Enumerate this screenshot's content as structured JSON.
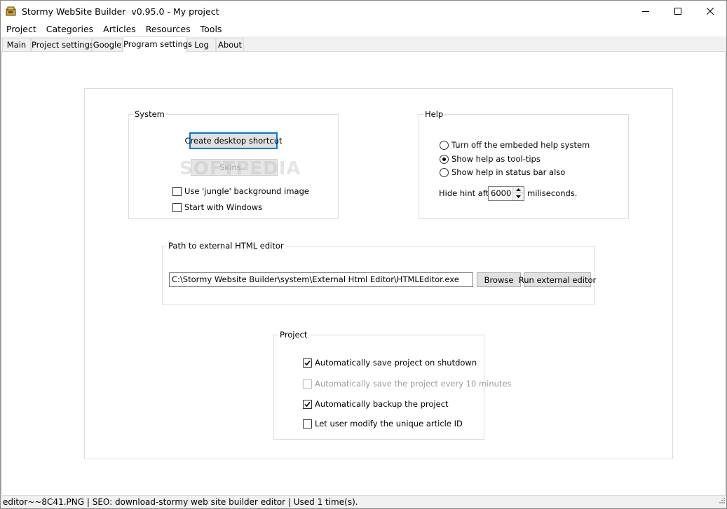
{
  "window": {
    "title": "Stormy WebSite Builder  v0.95.0 - My project"
  },
  "menu": [
    "Project",
    "Categories",
    "Articles",
    "Resources",
    "Tools"
  ],
  "tabs": [
    "Main",
    "Project settings",
    "Google",
    "Program settings",
    "Log",
    "About"
  ],
  "active_tab": "Program settings",
  "system_group": {
    "title": "System",
    "create_shortcut_label": "Create desktop shortcut",
    "skins_label": "Skins...",
    "jungle_bg_label": "Use 'jungle' background image",
    "jungle_bg_checked": false,
    "start_windows_label": "Start with Windows",
    "start_windows_checked": false
  },
  "help_group": {
    "title": "Help",
    "radio_options": [
      {
        "label": "Turn off the embeded help system",
        "selected": false
      },
      {
        "label": "Show help as tool-tips",
        "selected": true
      },
      {
        "label": "Show help in status bar also",
        "selected": false
      }
    ],
    "hide_hint_label": "Hide hint after",
    "hide_hint_value": "6000",
    "hide_hint_unit": "miliseconds."
  },
  "editor_group": {
    "title": "Path to external HTML editor",
    "path_value": "C:\\Stormy Website Builder\\system\\External Html Editor\\HTMLEditor.exe",
    "browse_label": "Browse",
    "run_label": "Run external editor"
  },
  "project_group": {
    "title": "Project",
    "options": [
      {
        "label": "Automatically save project on shutdown",
        "checked": true,
        "enabled": true
      },
      {
        "label": "Automatically save the project every 10 minutes",
        "checked": false,
        "enabled": false
      },
      {
        "label": "Automatically backup the project",
        "checked": true,
        "enabled": true
      },
      {
        "label": "Let user modify the unique article ID",
        "checked": false,
        "enabled": true
      }
    ]
  },
  "watermark": "SOFTPEDIA",
  "status_text": "editor~~8C41.PNG | SEO: download-stormy web site builder editor | Used 1 time(s).",
  "colors": {
    "focus_blue": "#0078d7",
    "chrome_gray": "#f0f0f0"
  }
}
